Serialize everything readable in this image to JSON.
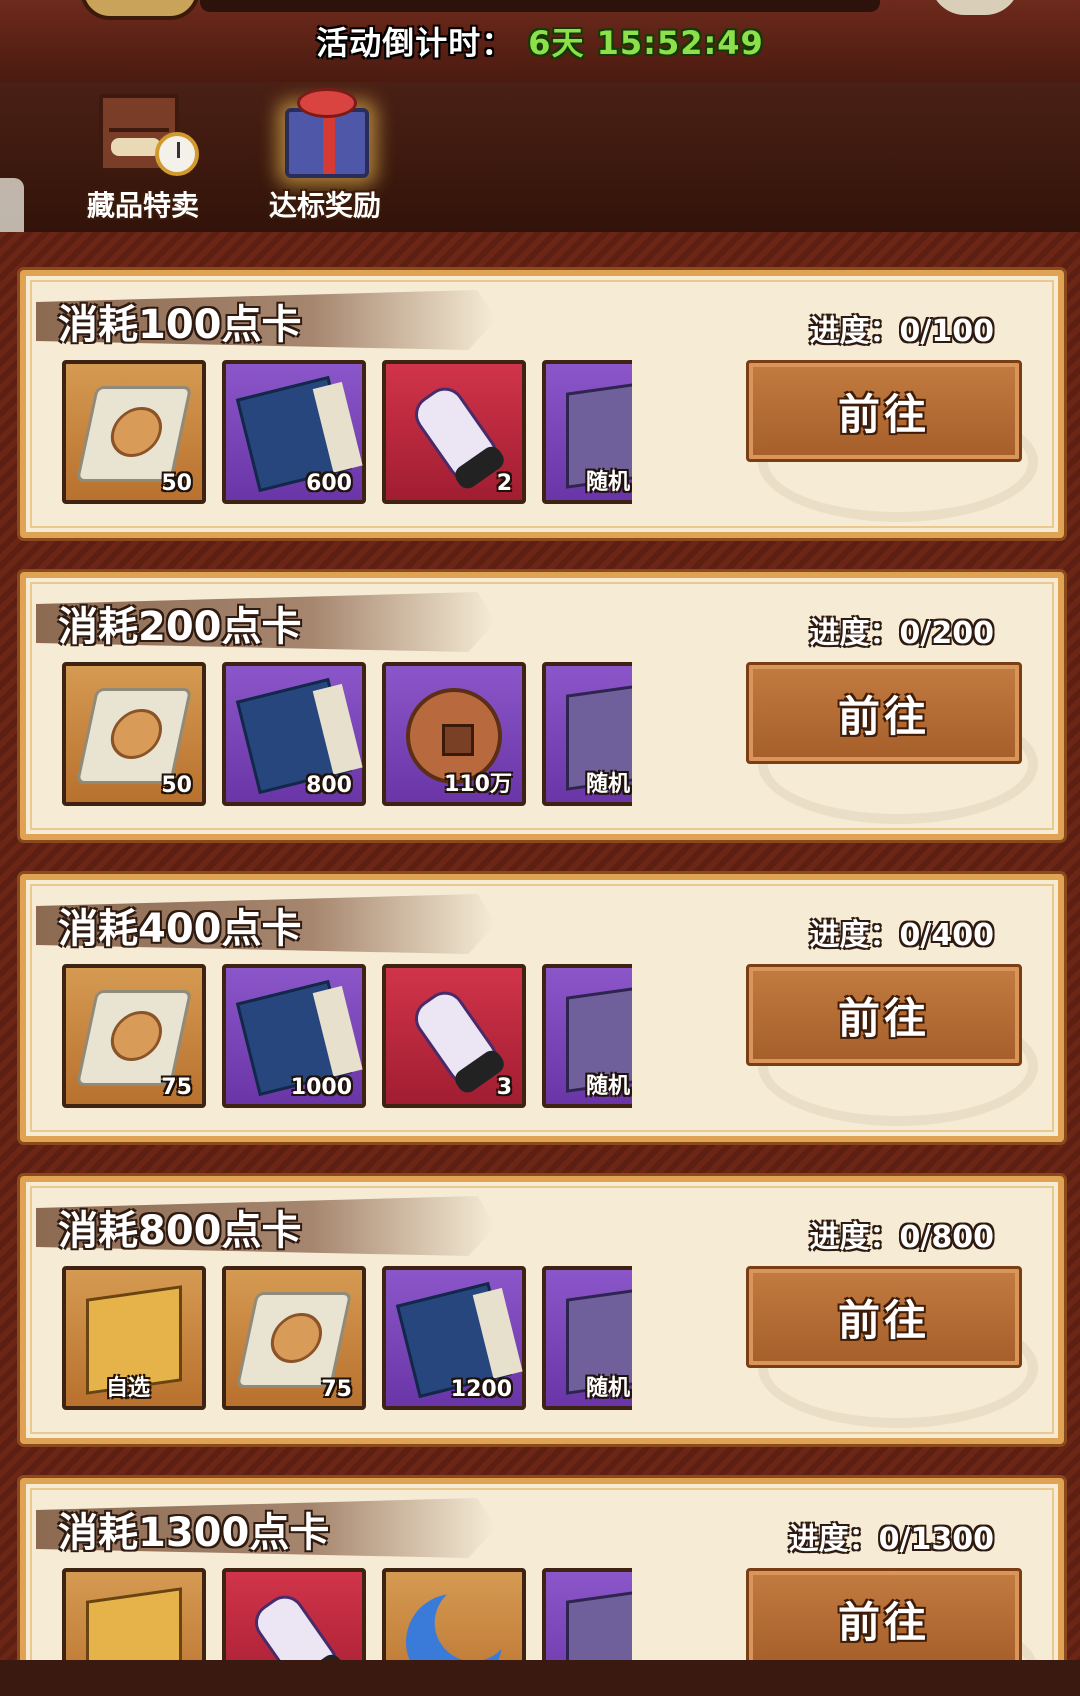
{
  "header": {
    "countdown_label": "活动倒计时：",
    "countdown_value": "6天 15:52:49"
  },
  "tabs": [
    {
      "label": "藏品特卖",
      "icon": "cabinet-clock-icon"
    },
    {
      "label": "达标奖励",
      "icon": "gift-box-icon"
    }
  ],
  "cards": [
    {
      "title": "消耗100点卡",
      "progress": "进度：0/100",
      "button": "前往",
      "items": [
        {
          "icon": "dango-plate-icon",
          "bg": "orange",
          "qty": "50"
        },
        {
          "icon": "blue-book-icon",
          "bg": "purple",
          "qty": "600"
        },
        {
          "icon": "scroll-icon",
          "bg": "red",
          "qty": "2"
        },
        {
          "icon": "random-chest-icon",
          "bg": "purple",
          "qty": "随机"
        }
      ]
    },
    {
      "title": "消耗200点卡",
      "progress": "进度：0/200",
      "button": "前往",
      "items": [
        {
          "icon": "dango-plate-icon",
          "bg": "orange",
          "qty": "50"
        },
        {
          "icon": "blue-book-icon",
          "bg": "purple",
          "qty": "800"
        },
        {
          "icon": "copper-coin-icon",
          "bg": "purple",
          "qty": "110万"
        },
        {
          "icon": "random-chest-icon",
          "bg": "purple",
          "qty": "随机"
        }
      ]
    },
    {
      "title": "消耗400点卡",
      "progress": "进度：0/400",
      "button": "前往",
      "items": [
        {
          "icon": "dango-plate-icon",
          "bg": "orange",
          "qty": "75"
        },
        {
          "icon": "blue-book-icon",
          "bg": "purple",
          "qty": "1000"
        },
        {
          "icon": "scroll-icon",
          "bg": "red",
          "qty": "3"
        },
        {
          "icon": "random-chest-icon",
          "bg": "purple",
          "qty": "随机"
        }
      ]
    },
    {
      "title": "消耗800点卡",
      "progress": "进度：0/800",
      "button": "前往",
      "items": [
        {
          "icon": "gold-chest-icon",
          "bg": "orange",
          "qty": "自选"
        },
        {
          "icon": "dango-plate-icon",
          "bg": "orange",
          "qty": "75"
        },
        {
          "icon": "blue-book-icon",
          "bg": "purple",
          "qty": "1200"
        },
        {
          "icon": "random-chest-icon",
          "bg": "purple",
          "qty": "随机"
        }
      ]
    },
    {
      "title": "消耗1300点卡",
      "progress": "进度：0/1300",
      "button": "前往",
      "items": [
        {
          "icon": "gold-chest-icon",
          "bg": "orange",
          "qty": ""
        },
        {
          "icon": "scroll-icon",
          "bg": "red",
          "qty": ""
        },
        {
          "icon": "blue-moon-icon",
          "bg": "orange",
          "qty": ""
        },
        {
          "icon": "random-chest-icon",
          "bg": "purple",
          "qty": ""
        }
      ]
    }
  ],
  "colors": {
    "countdown_value": "#8ee04a",
    "card_bg": "#f6ecd6",
    "button_bg": "#b36a33"
  }
}
